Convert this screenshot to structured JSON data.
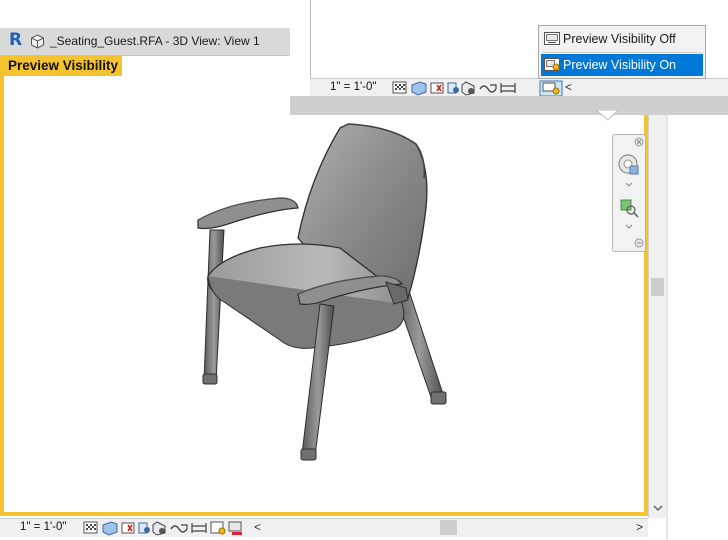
{
  "window": {
    "app_logo": "R",
    "title": "_Seating_Guest.RFA - 3D View: View 1"
  },
  "view": {
    "mode_label": "Preview Visibility"
  },
  "bottom_bar": {
    "scale": "1\" = 1'-0\"",
    "scroll_left": "<",
    "scroll_right": ">"
  },
  "zoom_panel": {
    "scale": "1\" = 1'-0\"",
    "scroll_left": "<"
  },
  "menu": {
    "items": [
      {
        "label": "Preview Visibility Off"
      },
      {
        "label": "Preview Visibility On"
      }
    ]
  },
  "toolbar_icons": [
    "detail-level-icon",
    "visual-style-icon",
    "sun-path-icon",
    "shadows-icon",
    "show-rendering-icon",
    "crop-view-icon",
    "show-crop-region-icon",
    "temporary-hide-icon",
    "reveal-hidden-icon",
    "preview-visibility-icon"
  ],
  "colors": {
    "highlight_border": "#f5c330",
    "menu_selection": "#0078d7",
    "logo_blue": "#1f5fb4"
  }
}
